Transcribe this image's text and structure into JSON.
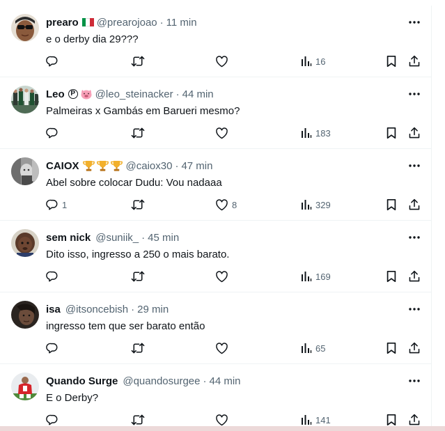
{
  "tweets": [
    {
      "name": "prearo",
      "badges": [
        "italy-flag"
      ],
      "handle": "@prearojoao",
      "time": "11 min",
      "text": "e o derby dia 29???",
      "reply_count": "",
      "retweet_count": "",
      "like_count": "",
      "views": "16",
      "avatar": "sunglasses-photo"
    },
    {
      "name": "Leo",
      "badges": [
        "p-circle",
        "pig-emoji"
      ],
      "handle": "@leo_steinacker",
      "time": "44 min",
      "text": "Palmeiras x Gambás em Barueri mesmo?",
      "reply_count": "",
      "retweet_count": "",
      "like_count": "",
      "views": "183",
      "avatar": "team-photo"
    },
    {
      "name": "CAIOX",
      "badges": [
        "trophy",
        "trophy",
        "trophy"
      ],
      "handle": "@caiox30",
      "time": "47 min",
      "text": "Abel sobre colocar Dudu: Vou nadaaa",
      "reply_count": "1",
      "retweet_count": "",
      "like_count": "8",
      "views": "329",
      "avatar": "grayscale-photo"
    },
    {
      "name": "sem nick",
      "badges": [],
      "handle": "@suniik_",
      "time": "45 min",
      "text": "Dito isso, ingresso a 250 o mais barato.",
      "reply_count": "",
      "retweet_count": "",
      "like_count": "",
      "views": "169",
      "avatar": "child-photo"
    },
    {
      "name": "isa",
      "badges": [],
      "handle": "@itsoncebish",
      "time": "29 min",
      "text": "ingresso tem que ser barato então",
      "reply_count": "",
      "retweet_count": "",
      "like_count": "",
      "views": "65",
      "avatar": "dark-photo"
    },
    {
      "name": "Quando Surge",
      "badges": [],
      "handle": "@quandosurgee",
      "time": "44 min",
      "text": "E o Derby?",
      "reply_count": "",
      "retweet_count": "",
      "like_count": "",
      "views": "141",
      "avatar": "red-jersey-photo"
    }
  ],
  "icons": {
    "more": "more-icon",
    "reply": "reply-icon",
    "retweet": "retweet-icon",
    "like": "like-icon",
    "views": "views-icon",
    "bookmark": "bookmark-icon",
    "share": "share-icon"
  },
  "colors": {
    "text": "#0f1419",
    "secondary": "#536471",
    "divider": "#eff3f4",
    "background": "#ffffff"
  }
}
